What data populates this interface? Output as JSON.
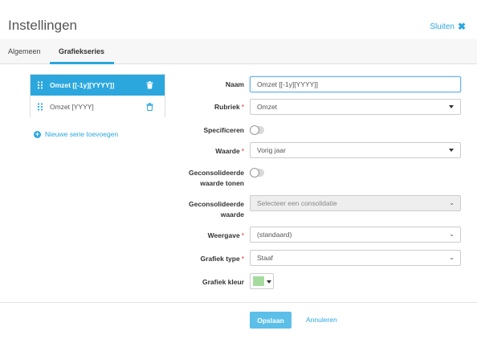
{
  "header": {
    "title": "Instellingen",
    "close_label": "Sluiten"
  },
  "tabs": [
    {
      "label": "Algemeen",
      "active": false
    },
    {
      "label": "Grafiekseries",
      "active": true
    }
  ],
  "series": [
    {
      "label": "Omzet [[-1y][YYYY]]",
      "active": true
    },
    {
      "label": "Omzet [YYYY]",
      "active": false
    }
  ],
  "add_series_label": "Nieuwe serie toevoegen",
  "form": {
    "naam": {
      "label": "Naam",
      "value": "Omzet [[-1y][YYYY]]"
    },
    "rubriek": {
      "label": "Rubriek",
      "required": "*",
      "value": "Omzet"
    },
    "specificeren": {
      "label": "Specificeren",
      "on": false
    },
    "waarde": {
      "label": "Waarde",
      "required": "*",
      "value": "Vorig jaar"
    },
    "geconsolideerde_tonen": {
      "label_line1": "Geconsolideerde",
      "label_line2": "waarde tonen",
      "on": false
    },
    "geconsolideerde_waarde": {
      "label_line1": "Geconsolideerde",
      "label_line2": "waarde",
      "placeholder": "Selecteer een consolidatie"
    },
    "weergave": {
      "label": "Weergave",
      "required": "*",
      "value": "(standaard)"
    },
    "grafiek_type": {
      "label": "Grafiek type",
      "required": "*",
      "value": "Staaf"
    },
    "grafiek_kleur": {
      "label": "Grafiek kleur",
      "color": "#a6dba0"
    }
  },
  "footer": {
    "save_label": "Opslaan",
    "cancel_label": "Annuleren"
  },
  "colors": {
    "accent": "#2ba7de",
    "save_button": "#5bbfe8"
  }
}
